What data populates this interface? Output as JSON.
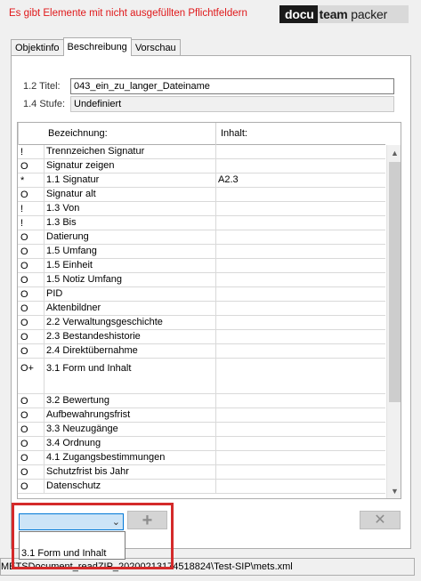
{
  "header": {
    "warning": "Es gibt Elemente mit nicht ausgefüllten Pflichtfeldern",
    "logo_docu": "docu",
    "logo_team": "team",
    "logo_packer": "packer"
  },
  "tabs": [
    {
      "label": "Objektinfo"
    },
    {
      "label": "Beschreibung",
      "active": true
    },
    {
      "label": "Vorschau"
    }
  ],
  "meta": {
    "title_label": "1.2 Titel:",
    "title_value": "043_ein_zu_langer_Dateiname",
    "level_label": "1.4 Stufe:",
    "level_value": "Undefiniert"
  },
  "table": {
    "headers": [
      "Bezeichnung:",
      "Inhalt:"
    ],
    "rows": [
      {
        "flag": "!",
        "label": "Trennzeichen Signatur",
        "value": ""
      },
      {
        "flag": "O",
        "label": "Signatur zeigen",
        "value": ""
      },
      {
        "flag": "*",
        "label": "1.1 Signatur",
        "value": "A2.3"
      },
      {
        "flag": "O",
        "label": "Signatur alt",
        "value": ""
      },
      {
        "flag": "!",
        "label": "1.3 Von",
        "value": ""
      },
      {
        "flag": "!",
        "label": "1.3 Bis",
        "value": ""
      },
      {
        "flag": "O",
        "label": "Datierung",
        "value": ""
      },
      {
        "flag": "O",
        "label": "1.5 Umfang",
        "value": ""
      },
      {
        "flag": "O",
        "label": "1.5 Einheit",
        "value": ""
      },
      {
        "flag": "O",
        "label": "1.5 Notiz Umfang",
        "value": ""
      },
      {
        "flag": "O",
        "label": "PID",
        "value": ""
      },
      {
        "flag": "O",
        "label": "Aktenbildner",
        "value": ""
      },
      {
        "flag": "O",
        "label": "2.2 Verwaltungsgeschichte",
        "value": ""
      },
      {
        "flag": "O",
        "label": "2.3 Bestandeshistorie",
        "value": ""
      },
      {
        "flag": "O",
        "label": "2.4 Direktübernahme",
        "value": ""
      },
      {
        "flag": "O+",
        "label": "3.1 Form und Inhalt",
        "value": "",
        "tall": true
      },
      {
        "flag": "O",
        "label": "3.2 Bewertung",
        "value": ""
      },
      {
        "flag": "O",
        "label": "Aufbewahrungsfrist",
        "value": ""
      },
      {
        "flag": "O",
        "label": "3.3 Neuzugänge",
        "value": ""
      },
      {
        "flag": "O",
        "label": "3.4 Ordnung",
        "value": ""
      },
      {
        "flag": "O",
        "label": "4.1 Zugangsbestimmungen",
        "value": ""
      },
      {
        "flag": "O",
        "label": "Schutzfrist bis Jahr",
        "value": ""
      },
      {
        "flag": "O",
        "label": "Datenschutz",
        "value": ""
      }
    ]
  },
  "controls": {
    "combo_value": "",
    "add_icon": "plus-icon",
    "delete_icon": "x-icon",
    "dropdown_options": [
      "3.1 Form und Inhalt"
    ]
  },
  "status": {
    "path": "METSDocument_readZIP_20200213174518824\\Test-SIP\\mets.xml"
  },
  "colors": {
    "warning": "#e0191b",
    "highlight": "#d42a2a",
    "combo_selected": "#cce4f7"
  }
}
